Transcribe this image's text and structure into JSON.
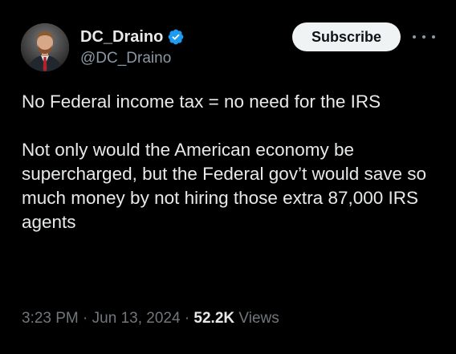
{
  "author": {
    "display_name": "DC_Draino",
    "handle": "@DC_Draino",
    "verified": true,
    "verified_color": "#1d9bf0"
  },
  "actions": {
    "subscribe_label": "Subscribe",
    "more_icon": "ellipsis-icon"
  },
  "tweet": {
    "paragraphs": [
      "No Federal income tax = no need for the IRS",
      "Not only would the American economy be supercharged, but the Federal gov’t would save so much money by not hiring those extra 87,000 IRS agents"
    ]
  },
  "meta": {
    "time": "3:23 PM",
    "separator": "·",
    "date": "Jun 13, 2024",
    "views_count": "52.2K",
    "views_label": "Views"
  },
  "colors": {
    "background": "#000000",
    "text_primary": "#e7e9ea",
    "text_secondary": "#71767b",
    "subscribe_bg": "#eff3f4"
  }
}
